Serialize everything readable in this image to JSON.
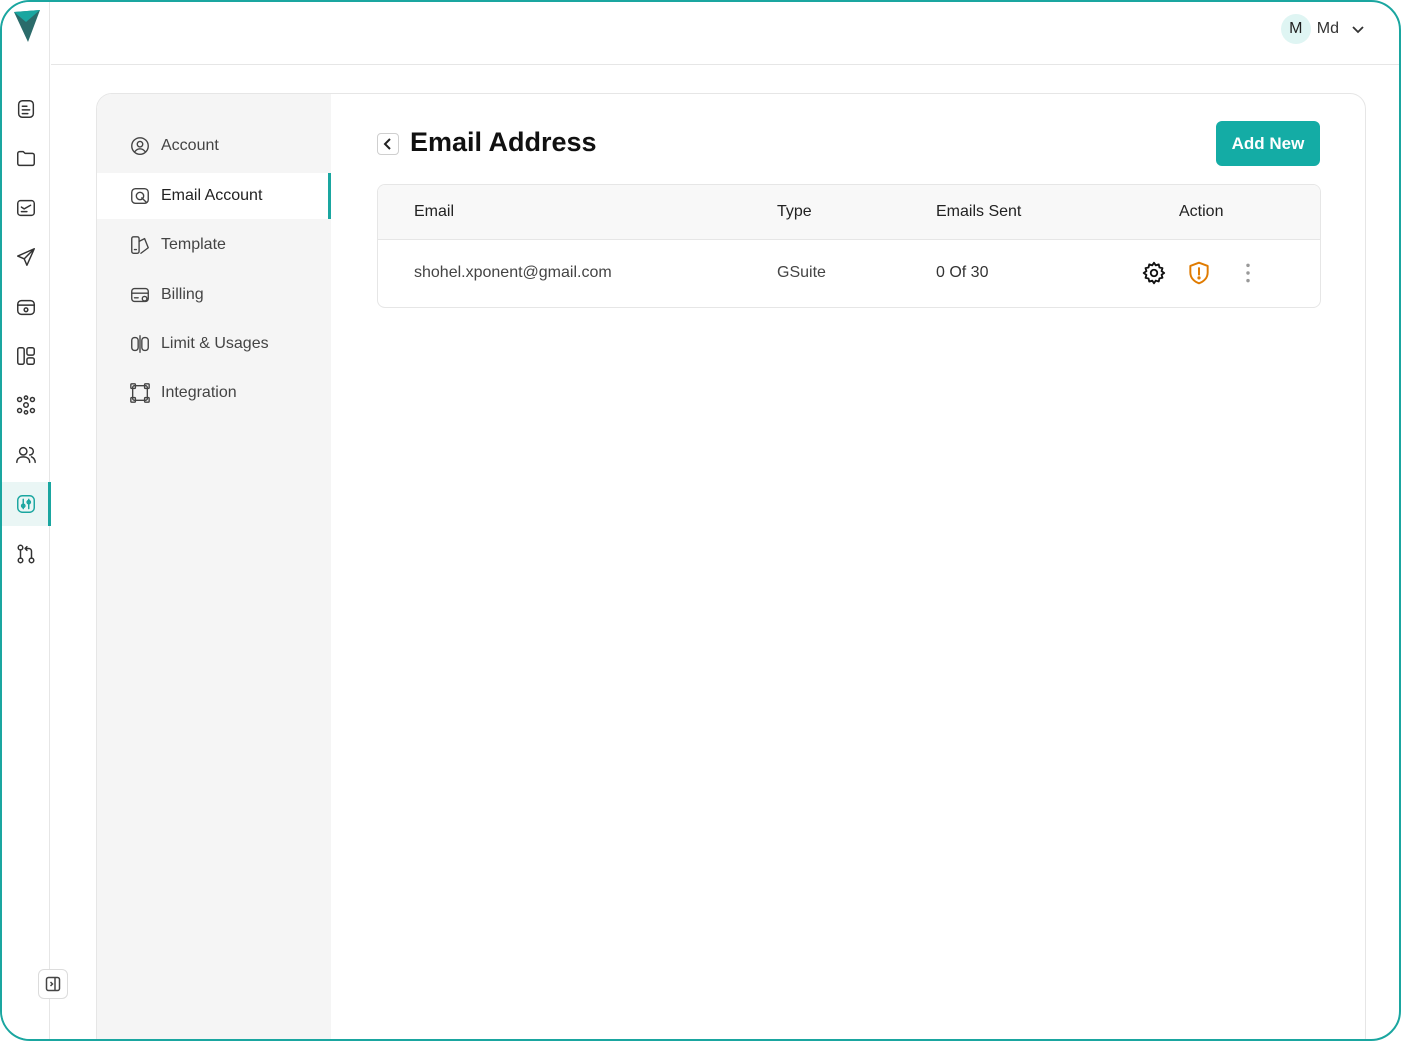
{
  "topbar": {
    "user": {
      "initial": "M",
      "name": "Md"
    }
  },
  "rail": {
    "items": [
      {
        "icon": "document-icon"
      },
      {
        "icon": "folder-icon"
      },
      {
        "icon": "inbox-icon"
      },
      {
        "icon": "send-icon"
      },
      {
        "icon": "calendar-icon"
      },
      {
        "icon": "dashboard-icon"
      },
      {
        "icon": "network-icon"
      },
      {
        "icon": "users-icon"
      },
      {
        "icon": "settings-sliders-icon",
        "active": true
      },
      {
        "icon": "git-pull-request-icon"
      }
    ],
    "collapse_icon": "sidebar-collapse-icon"
  },
  "settings_nav": {
    "items": [
      {
        "label": "Account",
        "icon": "user-circle-icon"
      },
      {
        "label": "Email Account",
        "icon": "email-account-icon",
        "active": true
      },
      {
        "label": "Template",
        "icon": "template-icon"
      },
      {
        "label": "Billing",
        "icon": "billing-icon"
      },
      {
        "label": "Limit & Usages",
        "icon": "limit-icon"
      },
      {
        "label": "Integration",
        "icon": "integration-icon"
      }
    ]
  },
  "main": {
    "title": "Email Address",
    "add_button": "Add New",
    "table": {
      "headers": [
        "Email",
        "Type",
        "Emails Sent",
        "Action"
      ],
      "rows": [
        {
          "email": "shohel.xponent@gmail.com",
          "type": "GSuite",
          "sent": "0 Of 30",
          "actions": [
            "gear-icon",
            "shield-alert-icon",
            "more-vertical-icon"
          ]
        }
      ]
    }
  },
  "colors": {
    "accent": "#1aa6a0",
    "button": "#14aca5",
    "warning": "#e07b00"
  }
}
